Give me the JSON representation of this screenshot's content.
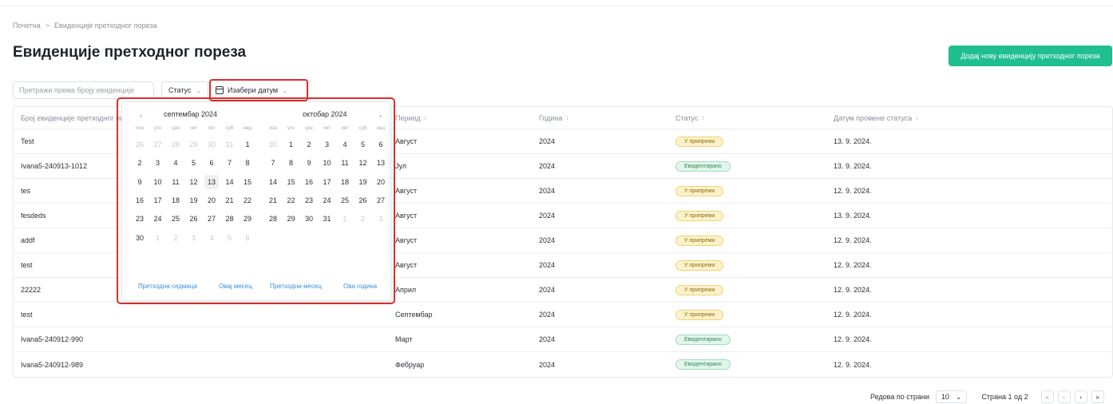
{
  "breadcrumb": {
    "home": "Почетна",
    "separator": ">",
    "current": "Евиденције претходног пореза"
  },
  "page": {
    "title": "Евиденције претходног пореза",
    "add_button": "Додај нову евиденцију претходног пореза"
  },
  "filters": {
    "search_placeholder": "Претражи према броју евиденције",
    "status_label": "Статус",
    "date_label": "Изабери датум",
    "chevron": "⌄"
  },
  "table": {
    "columns": [
      {
        "label": "Број евиденције претходног пореза"
      },
      {
        "label": "Период",
        "sort": "↕"
      },
      {
        "label": "Година",
        "sort": "↕"
      },
      {
        "label": "Статус",
        "sort": "↕"
      },
      {
        "label": "Датум промене статуса",
        "sort": "↓"
      }
    ],
    "rows": [
      {
        "number": "Test",
        "period": "Август",
        "year": "2024",
        "status": "У припреми",
        "status_type": "prep",
        "date": "13. 9. 2024."
      },
      {
        "number": "Ivana5-240913-1012",
        "period": "Јул",
        "year": "2024",
        "status": "Евидентирано",
        "status_type": "evid",
        "date": "13. 9. 2024."
      },
      {
        "number": "tes",
        "period": "Август",
        "year": "2024",
        "status": "У припреми",
        "status_type": "prep",
        "date": "12. 9. 2024."
      },
      {
        "number": "fesdeds",
        "period": "Август",
        "year": "2024",
        "status": "У припреми",
        "status_type": "prep",
        "date": "13. 9. 2024."
      },
      {
        "number": "addf",
        "period": "Август",
        "year": "2024",
        "status": "У припреми",
        "status_type": "prep",
        "date": "12. 9. 2024."
      },
      {
        "number": "test",
        "period": "Август",
        "year": "2024",
        "status": "У припреми",
        "status_type": "prep",
        "date": "12. 9. 2024."
      },
      {
        "number": "22222",
        "period": "Април",
        "year": "2024",
        "status": "У припреми",
        "status_type": "prep",
        "date": "12. 9. 2024."
      },
      {
        "number": "test",
        "period": "Септембар",
        "year": "2024",
        "status": "У припреми",
        "status_type": "prep",
        "date": "12. 9. 2024."
      },
      {
        "number": "Ivana5-240912-990",
        "period": "Март",
        "year": "2024",
        "status": "Евидентирано",
        "status_type": "evid",
        "date": "12. 9. 2024."
      },
      {
        "number": "Ivana5-240912-989",
        "period": "Фебруар",
        "year": "2024",
        "status": "Евидентирано",
        "status_type": "evid",
        "date": "12. 9. 2024."
      }
    ]
  },
  "pagination": {
    "rows_label": "Редова по страни",
    "rows_value": "10",
    "page_info": "Страна 1 од 2",
    "first": "«",
    "prev": "‹",
    "next": "›",
    "last": "»"
  },
  "calendar": {
    "prev_nav": "‹",
    "next_nav": "›",
    "weekdays": [
      "пон",
      "уто",
      "сре",
      "чет",
      "пет",
      "суб",
      "нед"
    ],
    "months": [
      {
        "title": "септембар 2024",
        "weeks": [
          [
            "26",
            "27",
            "28",
            "29",
            "30",
            "31",
            "1"
          ],
          [
            "2",
            "3",
            "4",
            "5",
            "6",
            "7",
            "8"
          ],
          [
            "9",
            "10",
            "11",
            "12",
            "13",
            "14",
            "15"
          ],
          [
            "16",
            "17",
            "18",
            "19",
            "20",
            "21",
            "22"
          ],
          [
            "23",
            "24",
            "25",
            "26",
            "27",
            "28",
            "29"
          ],
          [
            "30",
            "1",
            "2",
            "3",
            "4",
            "5",
            "6"
          ]
        ],
        "muted": [
          [
            0,
            0
          ],
          [
            0,
            1
          ],
          [
            0,
            2
          ],
          [
            0,
            3
          ],
          [
            0,
            4
          ],
          [
            0,
            5
          ],
          [
            5,
            1
          ],
          [
            5,
            2
          ],
          [
            5,
            3
          ],
          [
            5,
            4
          ],
          [
            5,
            5
          ],
          [
            5,
            6
          ]
        ],
        "today": [
          2,
          4
        ]
      },
      {
        "title": "октобар 2024",
        "weeks": [
          [
            "30",
            "1",
            "2",
            "3",
            "4",
            "5",
            "6"
          ],
          [
            "7",
            "8",
            "9",
            "10",
            "11",
            "12",
            "13"
          ],
          [
            "14",
            "15",
            "16",
            "17",
            "18",
            "19",
            "20"
          ],
          [
            "21",
            "22",
            "23",
            "24",
            "25",
            "26",
            "27"
          ],
          [
            "28",
            "29",
            "30",
            "31",
            "1",
            "2",
            "3"
          ]
        ],
        "muted": [
          [
            0,
            0
          ],
          [
            4,
            4
          ],
          [
            4,
            5
          ],
          [
            4,
            6
          ]
        ]
      }
    ],
    "presets": [
      "Претходна седмица",
      "Овај месец",
      "Претходни месец",
      "Ова година"
    ]
  },
  "colors": {
    "accent": "#1fbf8f",
    "highlight": "#d9302c",
    "link": "#3d8fd6"
  }
}
